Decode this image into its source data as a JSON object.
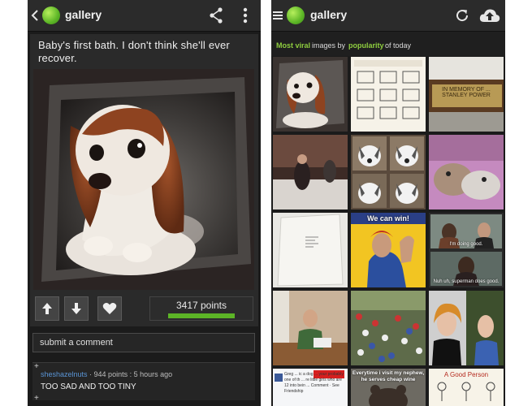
{
  "colors": {
    "accent": "#5cb526",
    "link": "#5a95d6",
    "bar_bg": "#2b2b2b",
    "screen_bg": "#1b1b1b"
  },
  "left_screen": {
    "app_title": "gallery",
    "icons": {
      "back": "chevron-left-icon",
      "share": "share-icon",
      "menu": "overflow-menu-icon"
    },
    "post": {
      "title": "Baby's first bath. I don't think she'll ever recover.",
      "points_label": "3417 points",
      "points_fill": 0.64
    },
    "comment_placeholder": "submit a comment",
    "comment": {
      "author": "sheshazelnuts",
      "meta": " · 944 points : 5 hours ago",
      "text": "TOO SAD AND TOO TINY",
      "expand_symbol": "+"
    }
  },
  "right_screen": {
    "app_title": "gallery",
    "icons": {
      "menu": "hamburger-icon",
      "refresh": "refresh-icon",
      "upload": "cloud-upload-icon"
    },
    "filter": {
      "sort": "Most viral",
      "middle": "images by",
      "order": "popularity",
      "range": "of today"
    },
    "thumbnails": [
      {
        "id": "puppy",
        "caption": ""
      },
      {
        "id": "instructions",
        "caption": ""
      },
      {
        "id": "memorial-plaque",
        "caption": "IN MEMORY OF ... STANLEY POWER"
      },
      {
        "id": "party",
        "caption": ""
      },
      {
        "id": "huskies",
        "caption": ""
      },
      {
        "id": "cats",
        "caption": ""
      },
      {
        "id": "paper-sheet",
        "caption": ""
      },
      {
        "id": "we-can-win",
        "caption": "We can win!"
      },
      {
        "id": "movie-scenes",
        "caption": "I'm doing good."
      },
      {
        "id": "boy-reading",
        "caption": ""
      },
      {
        "id": "crowd",
        "caption": ""
      },
      {
        "id": "portraits",
        "caption": ""
      },
      {
        "id": "facebook-post",
        "caption": "Greg ... ic a dog ... your probably one of th ... re little girls who are 12 into bein ... Comment · See Friendship"
      },
      {
        "id": "bear-meme",
        "caption": "Everytime i visit my nephew, he serves cheap wine"
      },
      {
        "id": "good-person-comic",
        "caption": "A Good Person"
      }
    ],
    "movie_caption_2": "Nuh uh, superman does good."
  }
}
